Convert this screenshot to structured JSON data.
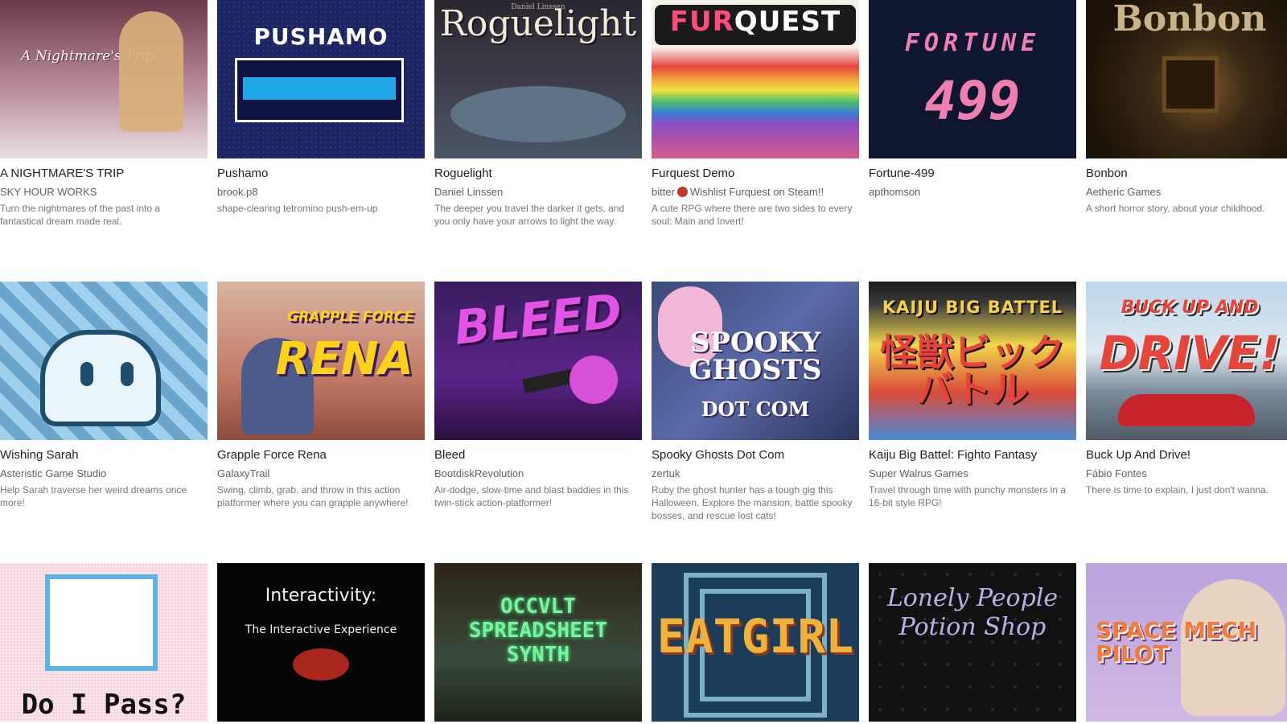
{
  "games": [
    {
      "title": "A NIGHTMARE'S TRIP",
      "author": "SKY HOUR WORKS",
      "description": "Turn the nightmares of the past into a fantastical dream made real.",
      "cover_text": "A Nightmare's Trip"
    },
    {
      "title": "Pushamo",
      "author": "brook.p8",
      "description": "shape-clearing tetromino push-em-up",
      "cover_text": "PUSHAMO"
    },
    {
      "title": "Roguelight",
      "author": "Daniel Linssen",
      "description": "The deeper you travel the darker it gets, and you only have your arrows to light the way.",
      "cover_text": "Roguelight",
      "cover_subtext": "Daniel Linssen"
    },
    {
      "title": "Furquest Demo",
      "author_prefix": "bitter",
      "author_suffix": "Wishlist Furquest on Steam!!",
      "description": "A cute RPG where there are two sides to every soul: Main and Invert!",
      "cover_text_a": "FUR",
      "cover_text_b": "QUEST"
    },
    {
      "title": "Fortune-499",
      "author": "apthomson",
      "description": "",
      "cover_text_1": "FORTUNE",
      "cover_text_2": "499"
    },
    {
      "title": "Bonbon",
      "author": "Aetheric Games",
      "description": "A short horror story, about your childhood.",
      "cover_text": "Bonbon"
    },
    {
      "title": "Wishing Sarah",
      "author": "Asteristic Game Studio",
      "description": "Help Sarah traverse her weird dreams once more!"
    },
    {
      "title": "Grapple Force Rena",
      "author": "GalaxyTrail",
      "description": "Swing, climb, grab, and throw in this action platformer where you can grapple anywhere!",
      "cover_text_1": "GRAPPLE FORCE",
      "cover_text_2": "RENA"
    },
    {
      "title": "Bleed",
      "author": "BootdiskRevolution",
      "description": "Air-dodge, slow-time and blast baddies in this twin-stick action-platformer!",
      "cover_text": "BLEED"
    },
    {
      "title": "Spooky Ghosts Dot Com",
      "author": "zertuk",
      "description": "Ruby the ghost hunter has a tough gig this Halloween. Explore the mansion, battle spooky bosses, and rescue lost cats!",
      "cover_text_1": "SPOOKY GHOSTS",
      "cover_text_2": "DOT COM"
    },
    {
      "title": "Kaiju Big Battel: Fighto Fantasy",
      "author": "Super Walrus Games",
      "description": "Travel through time with punchy monsters in a 16-bit style RPG!",
      "cover_text_1": "KAIJU BIG BATTEL",
      "cover_text_2": "怪獣ビックバトル"
    },
    {
      "title": "Buck Up And Drive!",
      "author": "Fábio Fontes",
      "description": "There is time to explain, I just don't wanna.",
      "cover_text_1": "BUCK UP AND",
      "cover_text_2": "DRIVE!"
    },
    {
      "title": "",
      "author": "",
      "description": "",
      "cover_text": "Do I Pass?"
    },
    {
      "title": "",
      "author": "",
      "description": "",
      "cover_text_1": "Interactivity:",
      "cover_text_2": "The Interactive Experience"
    },
    {
      "title": "",
      "author": "",
      "description": "",
      "cover_text": "OCCVLT SPREADSHEET SYNTH"
    },
    {
      "title": "",
      "author": "",
      "description": "",
      "cover_text": "EATGIRL"
    },
    {
      "title": "",
      "author": "",
      "description": "",
      "cover_text": "Lonely People Potion Shop"
    },
    {
      "title": "",
      "author": "",
      "description": "",
      "cover_text": "SPACE MECH PILOT"
    }
  ]
}
